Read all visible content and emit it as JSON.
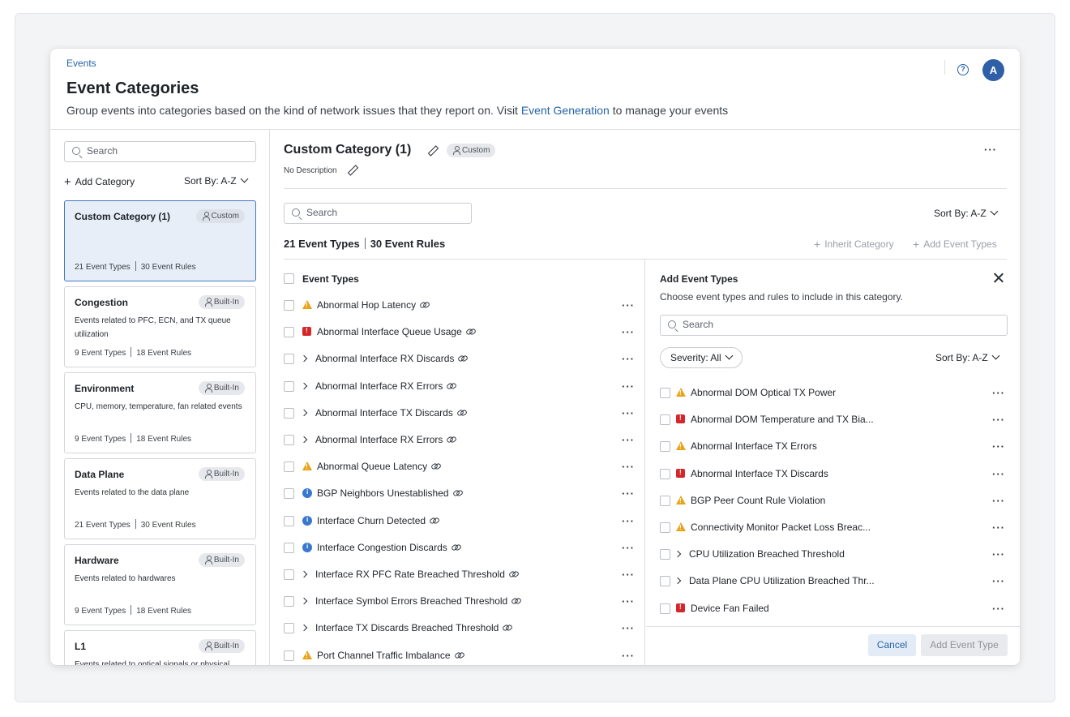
{
  "header": {
    "breadcrumb": "Events",
    "title": "Event Categories",
    "subtitle_prefix": "Group events into categories based on the kind of network issues that they report on. Visit ",
    "subtitle_link": "Event Generation",
    "subtitle_suffix": " to manage your events",
    "help_icon": "?",
    "avatar_initial": "A"
  },
  "sidebar": {
    "search_placeholder": "Search",
    "add_category_label": "Add Category",
    "sort_label": "Sort By: A-Z",
    "categories": [
      {
        "name": "Custom Category (1)",
        "badge": "Custom",
        "description": "",
        "event_types": "21 Event Types",
        "event_rules": "30 Event Rules",
        "selected": true
      },
      {
        "name": "Congestion",
        "badge": "Built-In",
        "description": "Events related to PFC, ECN, and TX queue utilization",
        "event_types": "9 Event Types",
        "event_rules": "18 Event Rules"
      },
      {
        "name": "Environment",
        "badge": "Built-In",
        "description": "CPU, memory, temperature, fan related events",
        "event_types": "9 Event Types",
        "event_rules": "18 Event Rules"
      },
      {
        "name": "Data Plane",
        "badge": "Built-In",
        "description": "Events related to the data plane",
        "event_types": "21 Event Types",
        "event_rules": "30 Event Rules"
      },
      {
        "name": "Hardware",
        "badge": "Built-In",
        "description": "Events related to hardwares",
        "event_types": "9 Event Types",
        "event_rules": "18 Event Rules"
      },
      {
        "name": "L1",
        "badge": "Built-In",
        "description": "Events related to optical signals or physical",
        "event_types": "",
        "event_rules": ""
      }
    ]
  },
  "detail": {
    "title": "Custom Category (1)",
    "badge": "Custom",
    "description": "No Description",
    "search_placeholder": "Search",
    "sort_label": "Sort By: A-Z",
    "event_types_count": "21 Event Types",
    "event_rules_count": "30 Event Rules",
    "inherit_label": "Inherit Category",
    "add_types_label": "Add Event Types",
    "list_header": "Event Types",
    "more": "···",
    "events": [
      {
        "label": "Abnormal Hop Latency",
        "icon": "warn"
      },
      {
        "label": "Abnormal Interface Queue Usage",
        "icon": "crit"
      },
      {
        "label": "Abnormal Interface RX Discards",
        "icon": "expand"
      },
      {
        "label": "Abnormal Interface RX Errors",
        "icon": "expand"
      },
      {
        "label": "Abnormal Interface TX Discards",
        "icon": "expand"
      },
      {
        "label": "Abnormal Interface RX Errors",
        "icon": "expand"
      },
      {
        "label": "Abnormal Queue Latency",
        "icon": "warn"
      },
      {
        "label": "BGP Neighbors Unestablished",
        "icon": "info"
      },
      {
        "label": "Interface Churn Detected",
        "icon": "info"
      },
      {
        "label": "Interface Congestion Discards",
        "icon": "info"
      },
      {
        "label": "Interface RX PFC Rate Breached Threshold",
        "icon": "expand"
      },
      {
        "label": "Interface Symbol Errors Breached Threshold",
        "icon": "expand"
      },
      {
        "label": "Interface TX Discards Breached Threshold",
        "icon": "expand"
      },
      {
        "label": "Port Channel Traffic Imbalance",
        "icon": "warn"
      }
    ]
  },
  "add_panel": {
    "title": "Add Event Types",
    "description": "Choose event types and rules to include in this category.",
    "search_placeholder": "Search",
    "severity_label": "Severity: All",
    "sort_label": "Sort By: A-Z",
    "items": [
      {
        "label": "Abnormal DOM Optical TX Power",
        "icon": "warn"
      },
      {
        "label": "Abnormal DOM Temperature and TX Bia...",
        "icon": "crit"
      },
      {
        "label": "Abnormal Interface TX Errors",
        "icon": "warn"
      },
      {
        "label": "Abnormal Interface TX Discards",
        "icon": "crit"
      },
      {
        "label": "BGP Peer Count Rule Violation",
        "icon": "warn"
      },
      {
        "label": "Connectivity Monitor Packet Loss Breac...",
        "icon": "warn"
      },
      {
        "label": "CPU Utilization Breached Threshold",
        "icon": "expand"
      },
      {
        "label": "Data Plane CPU Utilization Breached Thr...",
        "icon": "expand"
      },
      {
        "label": "Device Fan Failed",
        "icon": "crit"
      }
    ],
    "cancel_label": "Cancel",
    "add_label": "Add Event Type"
  }
}
